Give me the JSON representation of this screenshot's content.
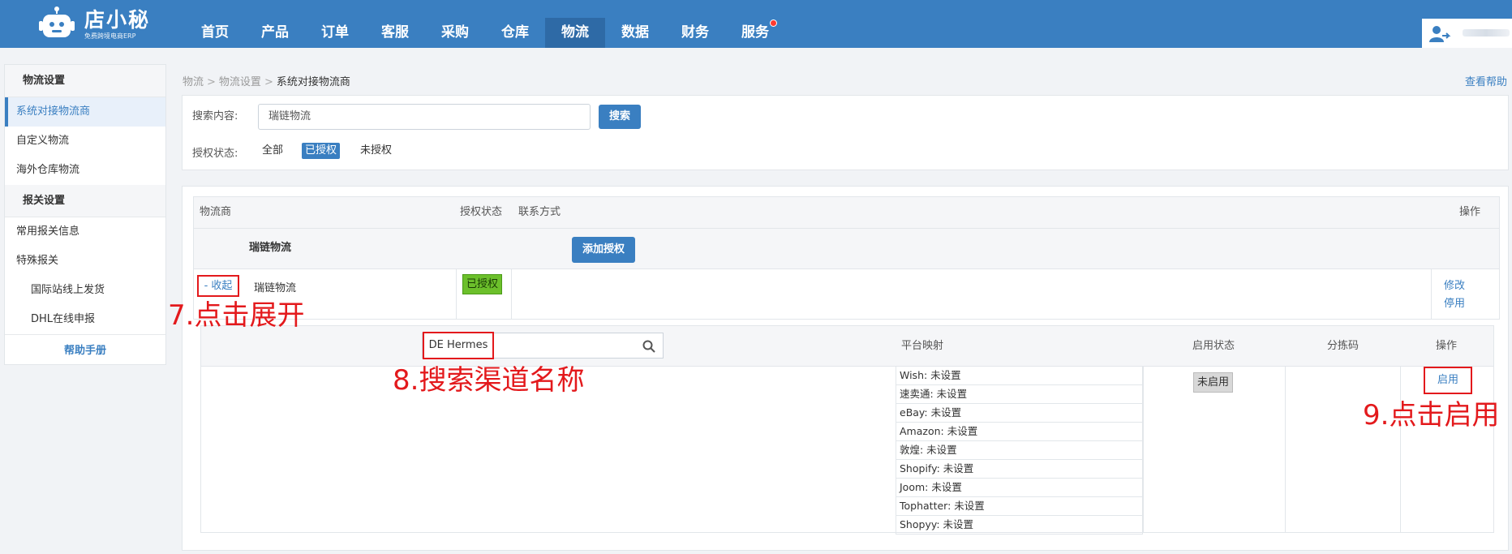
{
  "app": {
    "name": "店小秘",
    "subtitle": "免费跨境电商ERP"
  },
  "nav": {
    "items": [
      "首页",
      "产品",
      "订单",
      "客服",
      "采购",
      "仓库",
      "物流",
      "数据",
      "财务",
      "服务"
    ],
    "active": "物流",
    "badge_on": "服务"
  },
  "sidebar": {
    "groups": [
      {
        "title": "物流设置",
        "items": [
          {
            "label": "系统对接物流商",
            "active": true
          },
          {
            "label": "自定义物流"
          },
          {
            "label": "海外仓库物流"
          }
        ]
      },
      {
        "title": "报关设置",
        "items": [
          {
            "label": "常用报关信息"
          },
          {
            "label": "特殊报关"
          },
          {
            "label": "国际站线上发货",
            "sub": true
          },
          {
            "label": "DHL在线申报",
            "sub": true
          }
        ]
      }
    ],
    "help": "帮助手册"
  },
  "breadcrumb": [
    "物流",
    "物流设置",
    "系统对接物流商"
  ],
  "help_link": "查看帮助",
  "search": {
    "label": "搜索内容:",
    "value": "瑞链物流",
    "button": "搜索",
    "auth_label": "授权状态:",
    "filters": [
      "全部",
      "已授权",
      "未授权"
    ],
    "active_filter": "已授权"
  },
  "table": {
    "headers": {
      "carrier": "物流商",
      "auth_status": "授权状态",
      "contact": "联系方式",
      "action": "操作"
    },
    "group": {
      "name": "瑞链物流",
      "add_button": "添加授权"
    },
    "row": {
      "toggle": "- 收起",
      "carrier": "瑞链物流",
      "status": "已授权",
      "actions": [
        "修改",
        "停用"
      ]
    },
    "channel": {
      "search_value": "DE Hermes",
      "headers": {
        "platform": "平台映射",
        "status": "启用状态",
        "sort_code": "分拣码",
        "action": "操作"
      },
      "platforms": [
        {
          "name": "Wish",
          "value": "未设置"
        },
        {
          "name": "速卖通",
          "value": "未设置"
        },
        {
          "name": "eBay",
          "value": "未设置"
        },
        {
          "name": "Amazon",
          "value": "未设置"
        },
        {
          "name": "敦煌",
          "value": "未设置"
        },
        {
          "name": "Shopify",
          "value": "未设置"
        },
        {
          "name": "Joom",
          "value": "未设置"
        },
        {
          "name": "Tophatter",
          "value": "未设置"
        },
        {
          "name": "Shopyy",
          "value": "未设置"
        }
      ],
      "status": "未启用",
      "enable_button": "启用"
    }
  },
  "annotations": {
    "step7": "7.点击展开",
    "step8": "8.搜索渠道名称",
    "step9": "9.点击启用"
  },
  "colors": {
    "primary": "#3a7fc1",
    "nav_active": "#2e6aa6",
    "annotation_red": "#e3191c",
    "authorized_green": "#6cc02b"
  }
}
